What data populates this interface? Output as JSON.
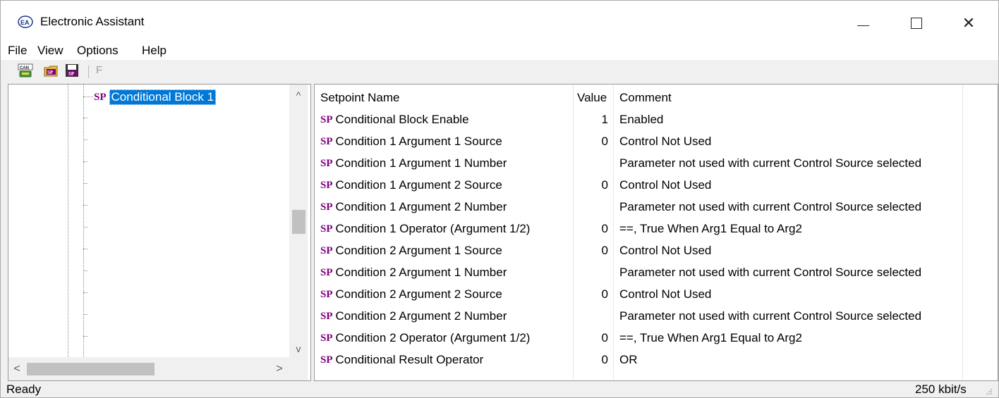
{
  "window": {
    "title": "Electronic Assistant",
    "controls": {
      "minimize": "",
      "maximize": "",
      "close": "✕"
    }
  },
  "menu": [
    "File",
    "View",
    "Options",
    "Help"
  ],
  "toolbar": {
    "buttons": [
      "can-icon",
      "sp-open-icon",
      "sp-save-icon"
    ],
    "f_label": "F"
  },
  "tree": {
    "selected_badge": "SP",
    "selected_label": "Conditional Block 1",
    "scroll_up": "^",
    "scroll_down": "v",
    "scroll_left": "<",
    "scroll_right": ">"
  },
  "table": {
    "headers": {
      "name": "Setpoint Name",
      "value": "Value",
      "comment": "Comment"
    },
    "badge": "SP",
    "rows": [
      {
        "name": "Conditional Block Enable",
        "value": "1",
        "comment": "Enabled"
      },
      {
        "name": "Condition 1 Argument 1 Source",
        "value": "0",
        "comment": "Control Not Used"
      },
      {
        "name": "Condition 1 Argument 1 Number",
        "value": "",
        "comment": "Parameter not used with current Control Source selected"
      },
      {
        "name": "Condition 1 Argument 2 Source",
        "value": "0",
        "comment": "Control Not Used"
      },
      {
        "name": "Condition 1 Argument 2 Number",
        "value": "",
        "comment": "Parameter not used with current Control Source selected"
      },
      {
        "name": "Condition 1 Operator (Argument 1/2)",
        "value": "0",
        "comment": "==, True When Arg1 Equal to Arg2"
      },
      {
        "name": "Condition 2 Argument 1 Source",
        "value": "0",
        "comment": "Control Not Used"
      },
      {
        "name": "Condition 2 Argument 1 Number",
        "value": "",
        "comment": "Parameter not used with current Control Source selected"
      },
      {
        "name": "Condition 2 Argument 2 Source",
        "value": "0",
        "comment": "Control Not Used"
      },
      {
        "name": "Condition 2 Argument 2 Number",
        "value": "",
        "comment": "Parameter not used with current Control Source selected"
      },
      {
        "name": "Condition 2 Operator (Argument 1/2)",
        "value": "0",
        "comment": "==, True When Arg1 Equal to Arg2"
      },
      {
        "name": "Conditional Result Operator",
        "value": "0",
        "comment": "OR"
      }
    ]
  },
  "status": {
    "left": "Ready",
    "right": "250 kbit/s"
  },
  "colors": {
    "selection": "#0078d7",
    "sp_badge": "#800080"
  }
}
